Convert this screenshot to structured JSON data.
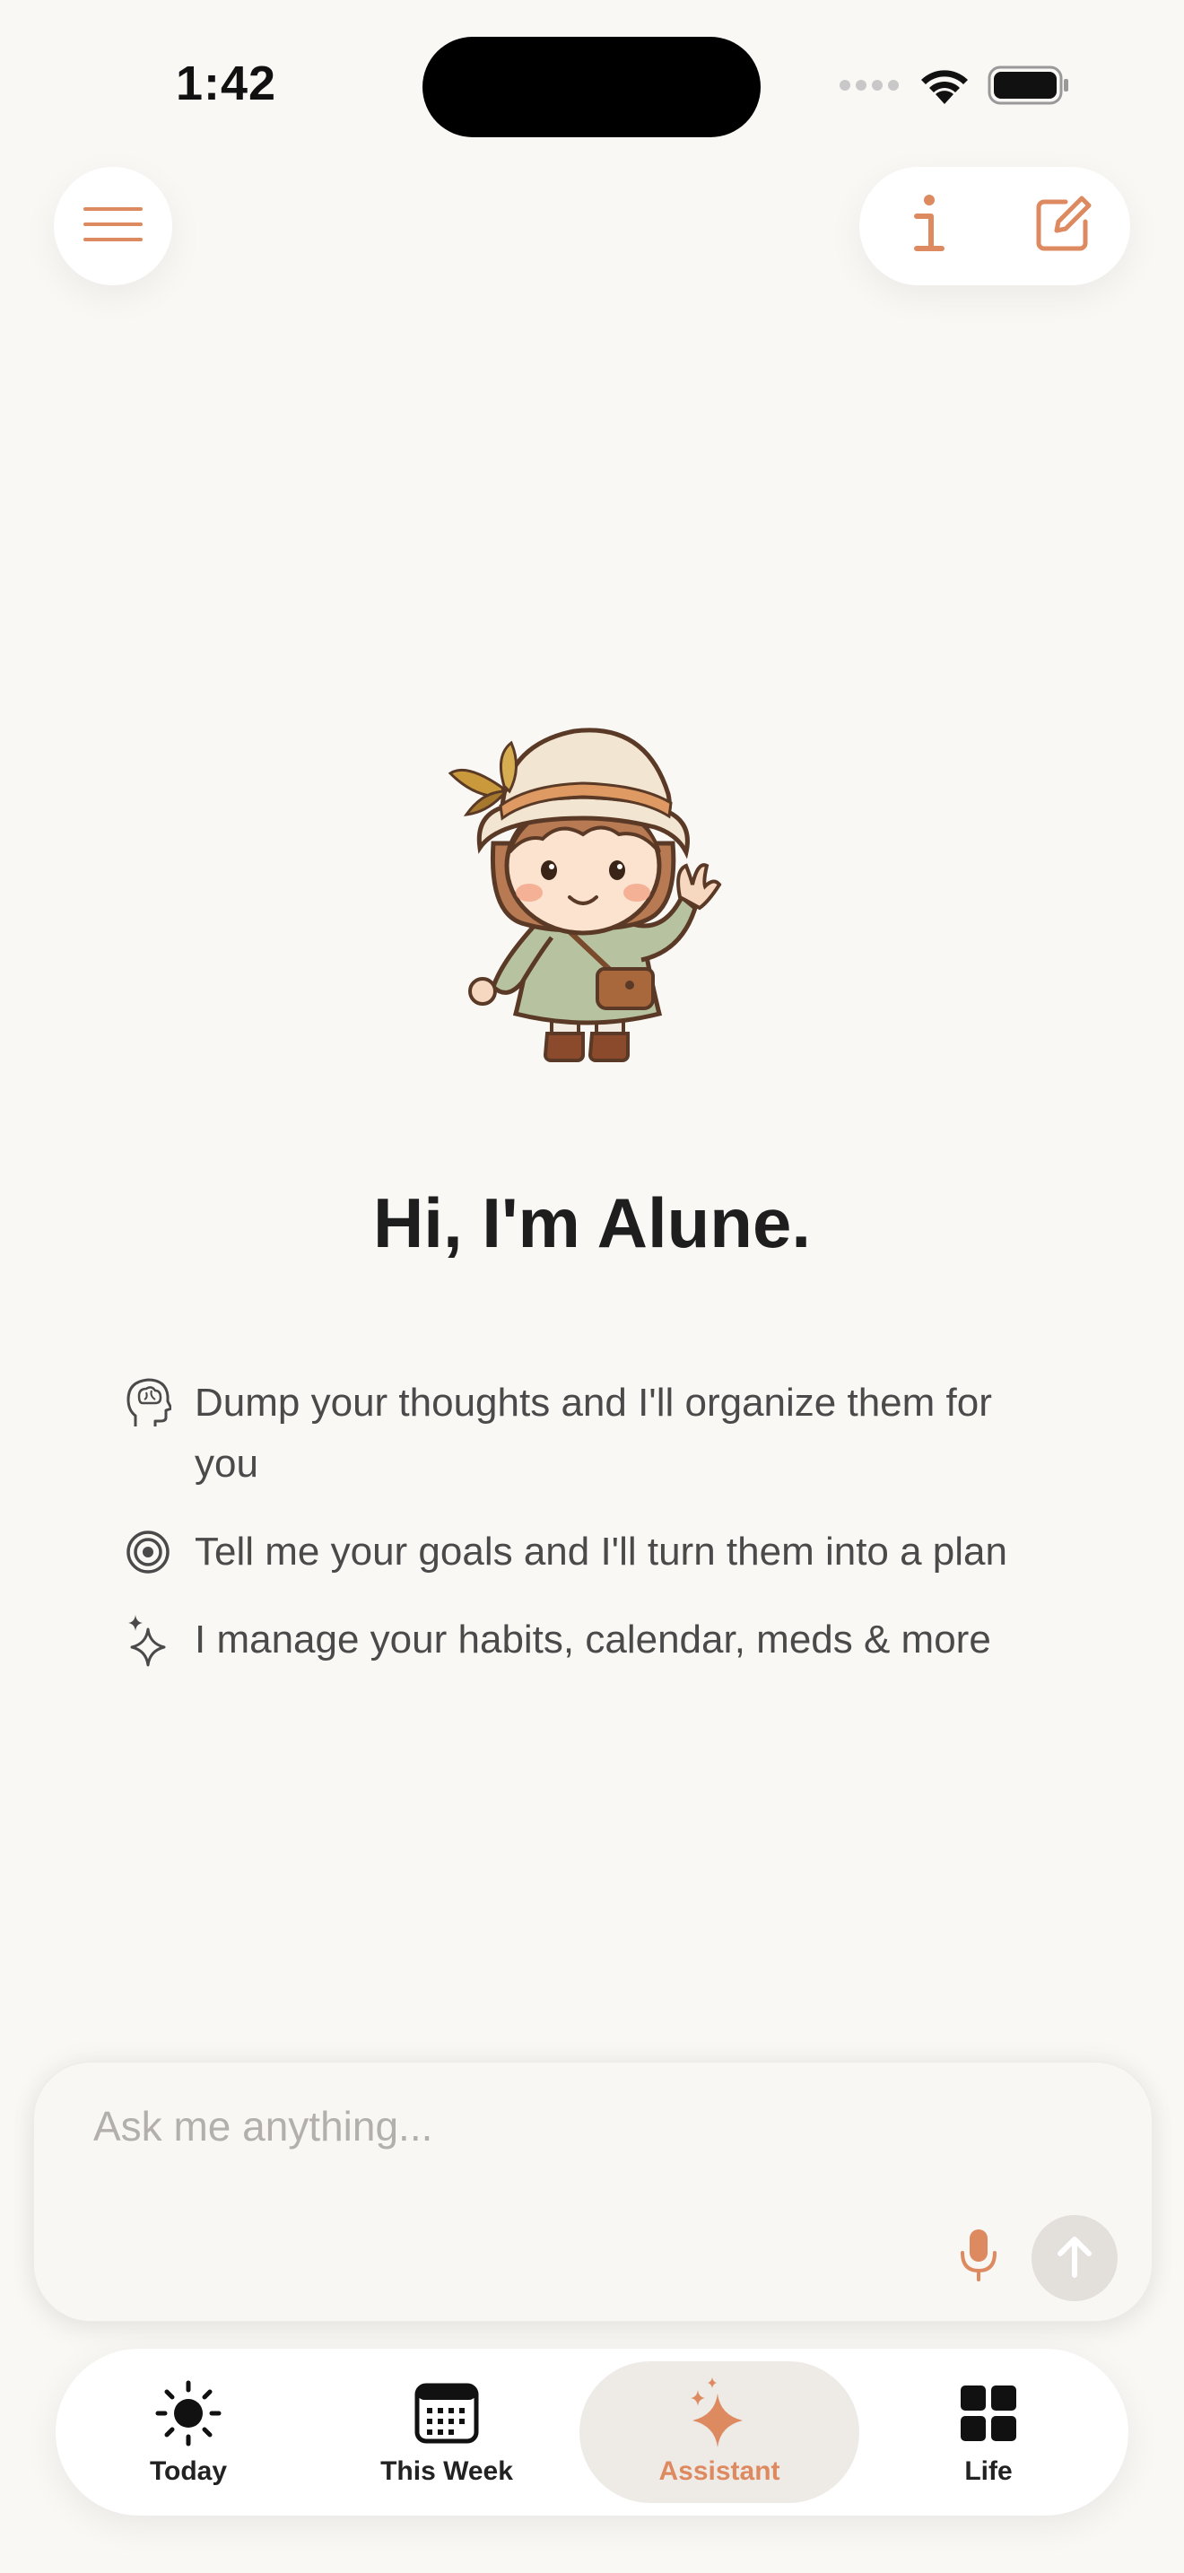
{
  "status_bar": {
    "time": "1:42"
  },
  "top_actions": {
    "menu_icon": "hamburger-menu-icon",
    "info_icon": "info-icon",
    "compose_icon": "compose-icon"
  },
  "greeting": "Hi, I'm Alune.",
  "features": [
    {
      "icon": "brain-head-icon",
      "text": "Dump your thoughts and I'll organize them for you"
    },
    {
      "icon": "target-icon",
      "text": "Tell me your goals and I'll turn them into a plan"
    },
    {
      "icon": "sparkles-icon",
      "text": "I manage your habits, calendar, meds & more"
    }
  ],
  "input": {
    "placeholder": "Ask me anything..."
  },
  "tabs": [
    {
      "label": "Today",
      "icon": "sun-icon"
    },
    {
      "label": "This Week",
      "icon": "calendar-icon"
    },
    {
      "label": "Assistant",
      "icon": "sparkle-icon",
      "active": true
    },
    {
      "label": "Life",
      "icon": "grid-icon"
    }
  ],
  "colors": {
    "accent": "#de8a61",
    "background": "#faf8f5",
    "text": "#1e1e1e",
    "muted_text": "#4a4a4a",
    "placeholder": "#b3b0ac"
  }
}
